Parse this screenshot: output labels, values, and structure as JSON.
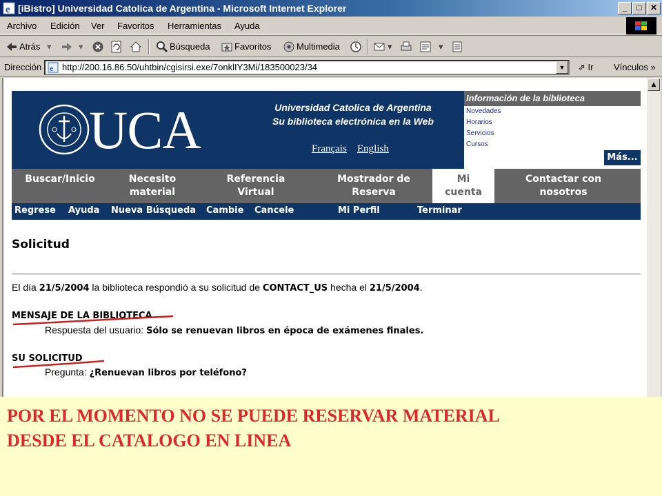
{
  "window": {
    "title": "[iBistro] Universidad Catolica de Argentina - Microsoft Internet Explorer",
    "controls": [
      "_",
      "□",
      "✕"
    ]
  },
  "menu": [
    "Archivo",
    "Edición",
    "Ver",
    "Favoritos",
    "Herramientas",
    "Ayuda"
  ],
  "toolbar": {
    "back": "Atrás",
    "search": "Búsqueda",
    "favorites": "Favoritos",
    "multimedia": "Multimedia"
  },
  "address": {
    "label": "Dirección",
    "url": "http://200.16.86.50/uhtbin/cgisirsi.exe/7onklIY3Mi/183500023/34",
    "go": "Ir",
    "links": "Vínculos"
  },
  "header": {
    "logo_text": "UCA",
    "uni_title_1": "Universidad Catolica de Argentina",
    "uni_title_2": "Su biblioteca electrónica en la Web",
    "lang_fr": "Français",
    "lang_en": "English"
  },
  "info": {
    "heading": "Información de la biblioteca",
    "links": [
      "Novedades",
      "Horarios",
      "Servicios",
      "Cursos"
    ],
    "more": "Más..."
  },
  "nav": [
    {
      "l1": "Buscar/Inicio",
      "l2": ""
    },
    {
      "l1": "Necesito",
      "l2": "material"
    },
    {
      "l1": "Referencia",
      "l2": "Virtual"
    },
    {
      "l1": "Mostrador de",
      "l2": "Reserva"
    },
    {
      "l1": "Mi",
      "l2": "cuenta"
    },
    {
      "l1": "Contactar con",
      "l2": "nosotros"
    }
  ],
  "subnav": [
    "Regrese",
    "Ayuda",
    "Nueva Búsqueda",
    "Cambie",
    "Cancele",
    "Mi Perfil",
    "Terminar"
  ],
  "content": {
    "heading": "Solicitud",
    "response_pre": "El día",
    "response_date": "21/5/2004",
    "response_mid": "la biblioteca respondió a su solicitud de",
    "response_type": "CONTACT_US",
    "response_mid2": "hecha el",
    "response_date2": "21/5/2004",
    "response_end": ".",
    "msg_title": "MENSAJE DE LA BIBLIOTECA",
    "msg_label": "Respuesta del usuario:",
    "msg_text": "Sólo se renuevan libros en época de exámenes finales.",
    "req_title": "SU SOLICITUD",
    "req_label": "Pregunta:",
    "req_text": "¿Renuevan libros por teléfono?"
  },
  "note": {
    "line1": "POR EL MOMENTO NO SE PUEDE RESERVAR MATERIAL",
    "line2": "DESDE EL CATALOGO EN LINEA"
  },
  "colors": {
    "navy": "#0e3566",
    "gray_nav": "#646464",
    "note_bg": "#ffffcc",
    "note_text": "#e0262b",
    "underline": "#cc1f1f"
  }
}
